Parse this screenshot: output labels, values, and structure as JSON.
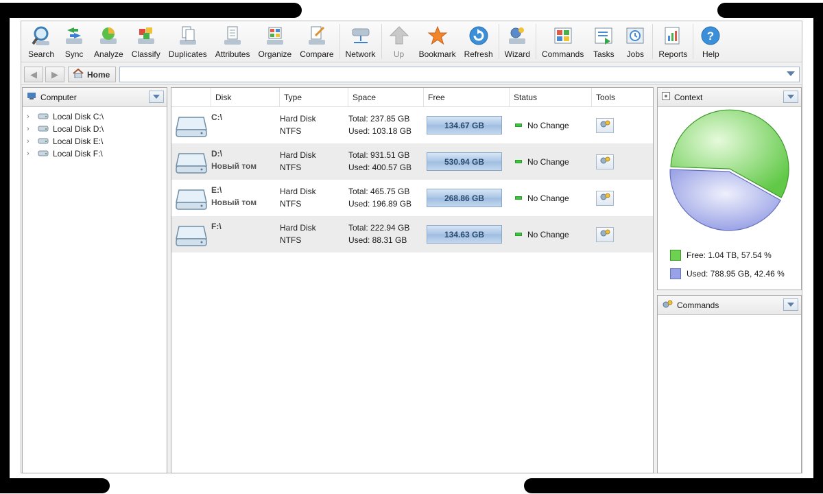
{
  "toolbar": {
    "buttons": [
      {
        "label": "Search",
        "icon": "search-icon"
      },
      {
        "label": "Sync",
        "icon": "sync-icon"
      },
      {
        "label": "Analyze",
        "icon": "analyze-icon"
      },
      {
        "label": "Classify",
        "icon": "classify-icon"
      },
      {
        "label": "Duplicates",
        "icon": "duplicates-icon"
      },
      {
        "label": "Attributes",
        "icon": "attributes-icon"
      },
      {
        "label": "Organize",
        "icon": "organize-icon"
      },
      {
        "label": "Compare",
        "icon": "compare-icon"
      },
      {
        "label": "Network",
        "icon": "network-icon"
      },
      {
        "label": "Up",
        "icon": "up-arrow-icon",
        "disabled": true
      },
      {
        "label": "Bookmark",
        "icon": "star-icon"
      },
      {
        "label": "Refresh",
        "icon": "refresh-icon"
      },
      {
        "label": "Wizard",
        "icon": "wizard-icon"
      },
      {
        "label": "Commands",
        "icon": "commands-icon"
      },
      {
        "label": "Tasks",
        "icon": "tasks-icon"
      },
      {
        "label": "Jobs",
        "icon": "jobs-icon"
      },
      {
        "label": "Reports",
        "icon": "reports-icon"
      },
      {
        "label": "Help",
        "icon": "help-icon"
      }
    ]
  },
  "address": {
    "home_label": "Home",
    "path_value": ""
  },
  "left_panel": {
    "title": "Computer",
    "items": [
      {
        "label": "Local Disk C:\\"
      },
      {
        "label": "Local Disk D:\\"
      },
      {
        "label": "Local Disk E:\\"
      },
      {
        "label": "Local Disk F:\\"
      }
    ]
  },
  "grid": {
    "columns": [
      "Disk",
      "Type",
      "Space",
      "Free",
      "Status",
      "Tools"
    ],
    "rows": [
      {
        "disk": "C:\\",
        "label": "",
        "type": "Hard Disk",
        "fs": "NTFS",
        "total": "Total: 237.85 GB",
        "used": "Used: 103.18 GB",
        "free": "134.67 GB",
        "status": "No Change"
      },
      {
        "disk": "D:\\",
        "label": "Новый том",
        "type": "Hard Disk",
        "fs": "NTFS",
        "total": "Total: 931.51 GB",
        "used": "Used: 400.57 GB",
        "free": "530.94 GB",
        "status": "No Change"
      },
      {
        "disk": "E:\\",
        "label": "Новый том",
        "type": "Hard Disk",
        "fs": "NTFS",
        "total": "Total: 465.75 GB",
        "used": "Used: 196.89 GB",
        "free": "268.86 GB",
        "status": "No Change"
      },
      {
        "disk": "F:\\",
        "label": "",
        "type": "Hard Disk",
        "fs": "NTFS",
        "total": "Total: 222.94 GB",
        "used": "Used: 88.31 GB",
        "free": "134.63 GB",
        "status": "No Change"
      }
    ]
  },
  "context_panel": {
    "title": "Context",
    "free_legend": "Free: 1.04 TB, 57.54 %",
    "used_legend": "Used: 788.95 GB, 42.46 %",
    "free_pct": 57.54,
    "used_pct": 42.46,
    "colors": {
      "free": "#7fd95f",
      "used": "#a4acec"
    }
  },
  "commands_panel": {
    "title": "Commands"
  }
}
